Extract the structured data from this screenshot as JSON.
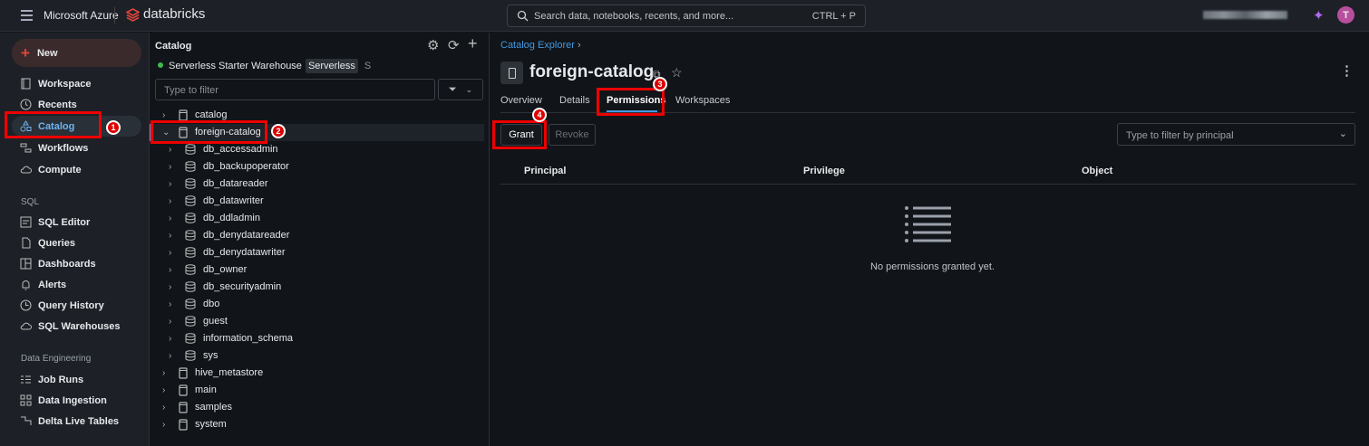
{
  "topbar": {
    "brand": "Microsoft Azure",
    "product": "databricks",
    "search_placeholder": "Search data, notebooks, recents, and more...",
    "search_shortcut": "CTRL + P",
    "avatar_initial": "T"
  },
  "sidebar": {
    "new_label": "New",
    "items": [
      {
        "label": "Workspace"
      },
      {
        "label": "Recents"
      },
      {
        "label": "Catalog"
      },
      {
        "label": "Workflows"
      },
      {
        "label": "Compute"
      }
    ],
    "sql_section": "SQL",
    "sql_items": [
      {
        "label": "SQL Editor"
      },
      {
        "label": "Queries"
      },
      {
        "label": "Dashboards"
      },
      {
        "label": "Alerts"
      },
      {
        "label": "Query History"
      },
      {
        "label": "SQL Warehouses"
      }
    ],
    "de_section": "Data Engineering",
    "de_items": [
      {
        "label": "Job Runs"
      },
      {
        "label": "Data Ingestion"
      },
      {
        "label": "Delta Live Tables"
      }
    ]
  },
  "catalog_panel": {
    "title": "Catalog",
    "warehouse": "Serverless Starter Warehouse",
    "warehouse_badge": "Serverless",
    "warehouse_size": "S",
    "filter_placeholder": "Type to filter",
    "tree": [
      {
        "label": "catalog",
        "level": 0,
        "kind": "catalog",
        "open": false
      },
      {
        "label": "foreign-catalog",
        "level": 0,
        "kind": "catalog",
        "open": true
      },
      {
        "label": "db_accessadmin",
        "level": 1,
        "kind": "schema"
      },
      {
        "label": "db_backupoperator",
        "level": 1,
        "kind": "schema"
      },
      {
        "label": "db_datareader",
        "level": 1,
        "kind": "schema"
      },
      {
        "label": "db_datawriter",
        "level": 1,
        "kind": "schema"
      },
      {
        "label": "db_ddladmin",
        "level": 1,
        "kind": "schema"
      },
      {
        "label": "db_denydatareader",
        "level": 1,
        "kind": "schema"
      },
      {
        "label": "db_denydatawriter",
        "level": 1,
        "kind": "schema"
      },
      {
        "label": "db_owner",
        "level": 1,
        "kind": "schema"
      },
      {
        "label": "db_securityadmin",
        "level": 1,
        "kind": "schema"
      },
      {
        "label": "dbo",
        "level": 1,
        "kind": "schema"
      },
      {
        "label": "guest",
        "level": 1,
        "kind": "schema"
      },
      {
        "label": "information_schema",
        "level": 1,
        "kind": "schema"
      },
      {
        "label": "sys",
        "level": 1,
        "kind": "schema"
      },
      {
        "label": "hive_metastore",
        "level": 0,
        "kind": "catalog",
        "open": false
      },
      {
        "label": "main",
        "level": 0,
        "kind": "catalog",
        "open": false
      },
      {
        "label": "samples",
        "level": 0,
        "kind": "catalog",
        "open": false
      },
      {
        "label": "system",
        "level": 0,
        "kind": "catalog",
        "open": false
      }
    ]
  },
  "main": {
    "breadcrumb": "Catalog Explorer",
    "title": "foreign-catalog",
    "tabs": [
      {
        "label": "Overview"
      },
      {
        "label": "Details"
      },
      {
        "label": "Permissions"
      },
      {
        "label": "Workspaces"
      }
    ],
    "grant_label": "Grant",
    "revoke_label": "Revoke",
    "principal_filter_placeholder": "Type to filter by principal",
    "columns": [
      "Principal",
      "Privilege",
      "Object"
    ],
    "empty_text": "No permissions granted yet."
  },
  "annotations": [
    "1",
    "2",
    "3",
    "4"
  ],
  "colors": {
    "accent": "#4299e0",
    "annotation": "#e00000",
    "new_plus": "#e0463c"
  }
}
